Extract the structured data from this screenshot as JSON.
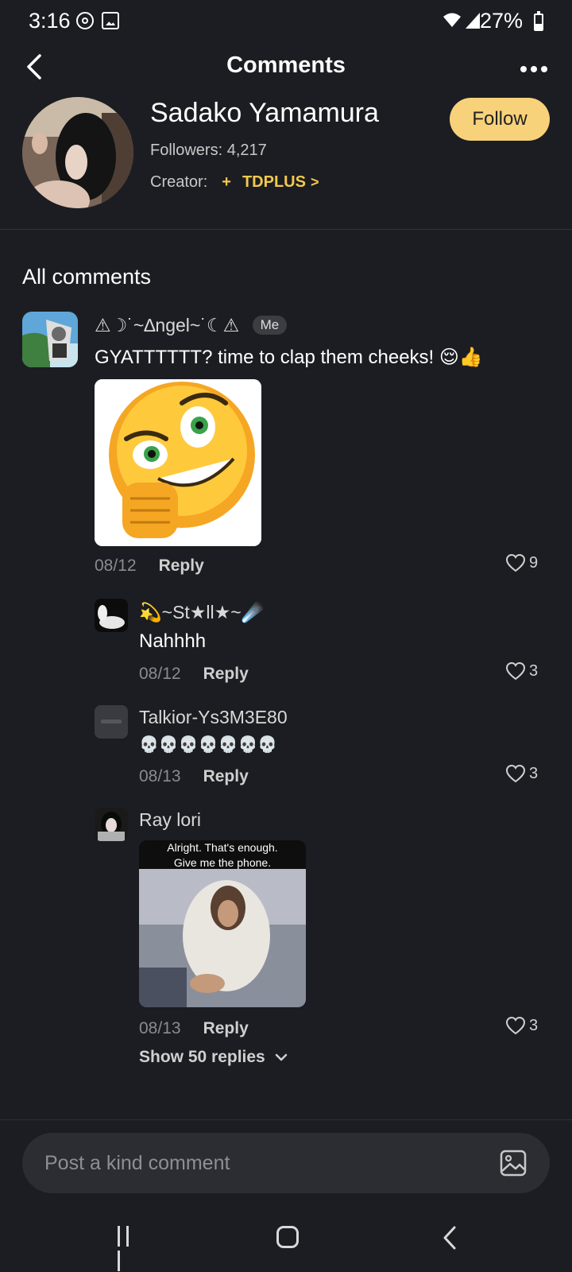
{
  "status": {
    "time": "3:16",
    "battery": "27%"
  },
  "header": {
    "title": "Comments"
  },
  "profile": {
    "name": "Sadako Yamamura",
    "followers_label": "Followers:",
    "followers_count": "4,217",
    "creator_label": "Creator:",
    "creator_link": "TDPLUS",
    "follow_label": "Follow"
  },
  "section_title": "All comments",
  "comments": [
    {
      "username": "⚠︎☽˙~∆ngel~˙☾⚠︎",
      "badge": "Me",
      "text": "GYATTTTTT? time to clap them cheeks! 😌👍",
      "date": "08/12",
      "reply_label": "Reply",
      "likes": "9"
    },
    {
      "username": "💫~St★ll★~☄️",
      "text": "Nahhhh",
      "date": "08/12",
      "reply_label": "Reply",
      "likes": "3"
    },
    {
      "username": "Talkior-Ys3M3E80",
      "text": "💀💀💀💀💀💀💀",
      "date": "08/13",
      "reply_label": "Reply",
      "likes": "3"
    },
    {
      "username": "Ray lori",
      "image_caption": "Alright. That's enough.\nGive me the phone.",
      "date": "08/13",
      "reply_label": "Reply",
      "likes": "3"
    }
  ],
  "show_replies": "Show 50 replies",
  "input": {
    "placeholder": "Post a kind comment"
  },
  "colors": {
    "background": "#1c1d22",
    "accent": "#f4c84e",
    "follow_button": "#f8d27a"
  }
}
